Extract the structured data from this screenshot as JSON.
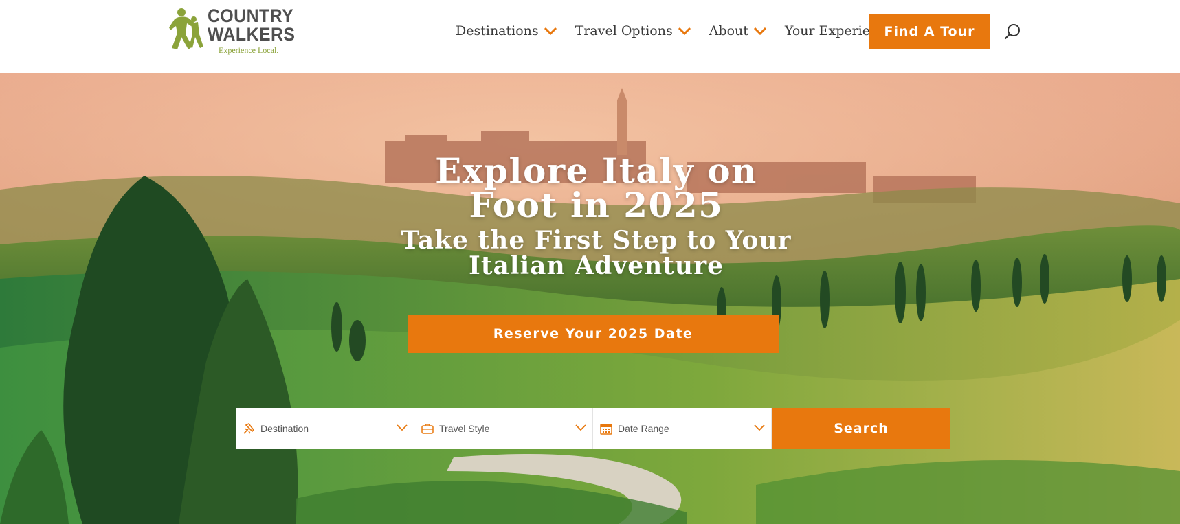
{
  "brand": {
    "name_line1": "COUNTRY",
    "name_line2": "WALKERS",
    "tagline": "Experience Local.",
    "logo_color": "#8ba33a"
  },
  "nav": {
    "items": [
      {
        "label": "Destinations",
        "has_dropdown": true
      },
      {
        "label": "Travel Options",
        "has_dropdown": true
      },
      {
        "label": "About",
        "has_dropdown": true
      },
      {
        "label": "Your Experience",
        "has_dropdown": false
      }
    ],
    "cta_label": "Find A Tour",
    "search_icon": "search-icon"
  },
  "hero": {
    "title": "Explore Italy on Foot in 2025",
    "subtitle": "Take the First Step to Your Italian Adventure",
    "cta_label": "Reserve Your 2025 Date"
  },
  "search": {
    "fields": [
      {
        "label": "Destination",
        "icon": "airplane-icon"
      },
      {
        "label": "Travel Style",
        "icon": "suitcase-icon"
      },
      {
        "label": "Date Range",
        "icon": "calendar-icon"
      }
    ],
    "button_label": "Search"
  },
  "colors": {
    "accent": "#e8780e",
    "nav_text": "#3a3a3a",
    "logo_green": "#8ba33a"
  }
}
